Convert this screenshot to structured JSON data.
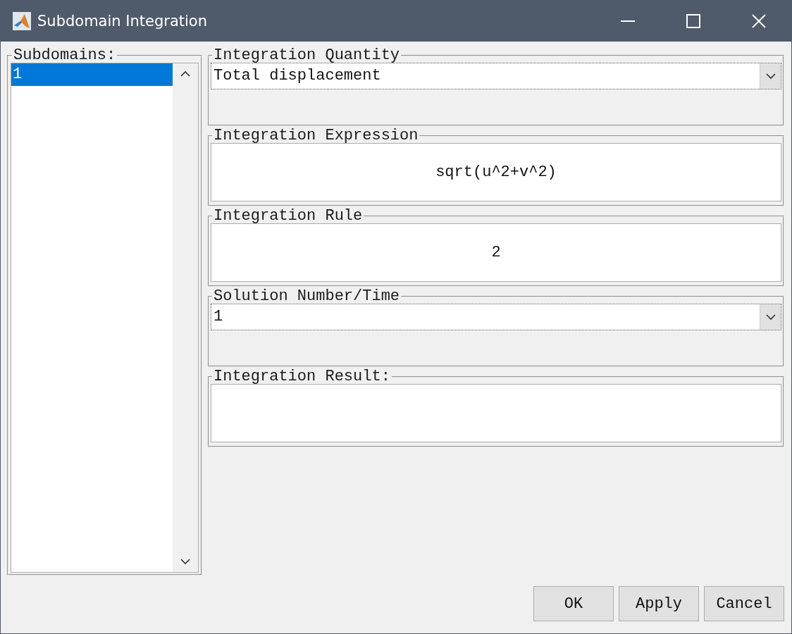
{
  "window": {
    "title": "Subdomain Integration"
  },
  "subdomains": {
    "label": "Subdomains:",
    "items": [
      {
        "label": "1",
        "selected": true
      }
    ]
  },
  "groups": [
    {
      "kind": "dropdown",
      "label": "Integration Quantity",
      "value": "Total displacement"
    },
    {
      "kind": "text",
      "label": "Integration Expression",
      "value": "sqrt(u^2+v^2)"
    },
    {
      "kind": "text",
      "label": "Integration Rule",
      "value": "2"
    },
    {
      "kind": "dropdown",
      "label": "Solution Number/Time",
      "value": "1"
    },
    {
      "kind": "result",
      "label": "Integration Result:"
    }
  ],
  "buttons": [
    "OK",
    "Apply",
    "Cancel"
  ]
}
